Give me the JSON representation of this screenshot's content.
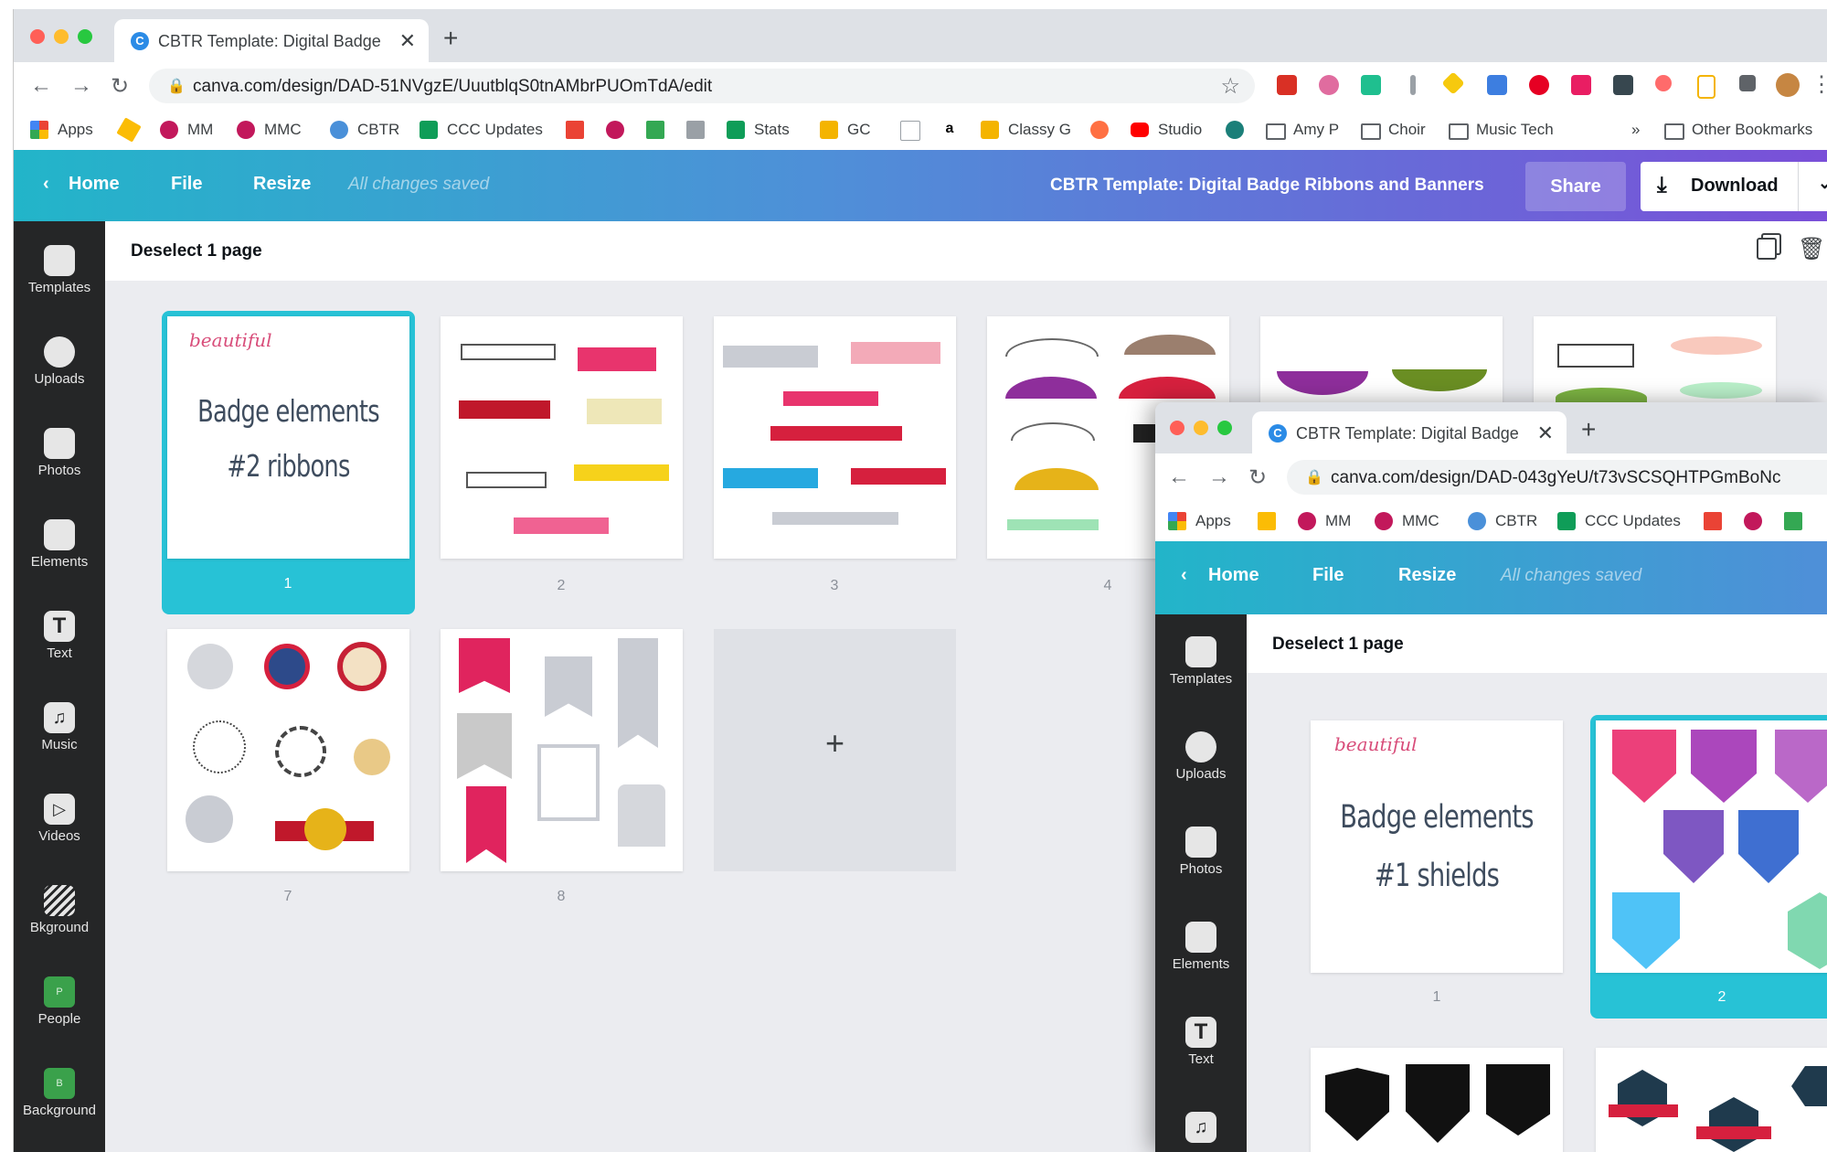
{
  "browser": {
    "tab_title": "CBTR Template: Digital Badge",
    "url": "canva.com/design/DAD-51NVgzE/UuutblqS0tnAMbrPUOmTdA/edit"
  },
  "bookmarks": [
    "Apps",
    "MM",
    "MMC",
    "CBTR",
    "CCC Updates",
    "Stats",
    "GC",
    "Classy G",
    "Studio",
    "Amy P",
    "Choir",
    "Music Tech",
    "Other Bookmarks"
  ],
  "bookmarks_overflow": "»",
  "canva_header": {
    "home": "Home",
    "file": "File",
    "resize": "Resize",
    "saved": "All changes saved",
    "title": "CBTR Template: Digital Badge Ribbons and Banners",
    "share": "Share",
    "download": "Download"
  },
  "sidebar": [
    "Templates",
    "Uploads",
    "Photos",
    "Elements",
    "Text",
    "Music",
    "Videos",
    "Bkground",
    "People",
    "Background"
  ],
  "sidebar_tags": {
    "people": "P",
    "background": "B"
  },
  "pagebar": {
    "deselect": "Deselect 1 page"
  },
  "page_numbers": [
    "1",
    "2",
    "3",
    "4",
    "7",
    "8"
  ],
  "page1": {
    "brand": "beautiful",
    "line1": "Badge elements",
    "line2": "#2 ribbons"
  },
  "add_page": "+",
  "window2": {
    "tab_title": "CBTR Template: Digital Badge",
    "url": "canva.com/design/DAD-043gYeU/t73vSCSQHTPGmBoNc",
    "bookmarks": [
      "Apps",
      "MM",
      "MMC",
      "CBTR",
      "CCC Updates"
    ],
    "home": "Home",
    "file": "File",
    "resize": "Resize",
    "saved": "All changes saved",
    "deselect": "Deselect 1 page",
    "sidebar": [
      "Templates",
      "Uploads",
      "Photos",
      "Elements",
      "Text"
    ],
    "page1": {
      "brand": "beautiful",
      "line1": "Badge elements",
      "line2": "#1 shields"
    },
    "page_numbers": [
      "1",
      "2"
    ]
  },
  "colors": {
    "accent": "#27c2d6",
    "header_start": "#22b5c9",
    "header_end": "#7a4fd8",
    "sidebar_bg": "#252627",
    "ribbon_pink": "#e8346d",
    "ribbon_red": "#d6203e"
  }
}
